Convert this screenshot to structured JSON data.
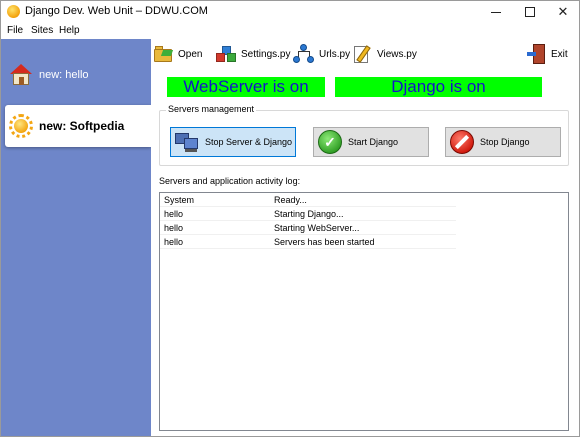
{
  "window": {
    "title": "Django Dev. Web Unit – DDWU.COM",
    "controls": {
      "minimize": "",
      "maximize": "",
      "close": "✕"
    }
  },
  "menu": [
    "File",
    "Sites",
    "Help"
  ],
  "sidebar": {
    "tabs": [
      {
        "label": "new: hello",
        "icon": "house-icon",
        "selected": false
      },
      {
        "label": "new: Softpedia",
        "icon": "sun-icon",
        "selected": true
      }
    ]
  },
  "toolbar": {
    "open": "Open",
    "settings": "Settings.py",
    "urls": "Urls.py",
    "views": "Views.py",
    "exit": "Exit"
  },
  "status": {
    "webserver": "WebServer is on",
    "django": "Django is on",
    "on_color": "#00ff00",
    "text_color": "#1414c8"
  },
  "servers": {
    "legend": "Servers management",
    "stop_all": "Stop Server & Django",
    "start_django": "Start Django",
    "stop_django": "Stop Django"
  },
  "log": {
    "label": "Servers and application activity log:",
    "rows": [
      {
        "source": "System",
        "message": "Ready..."
      },
      {
        "source": "hello",
        "message": "Starting Django..."
      },
      {
        "source": "hello",
        "message": "Starting WebServer..."
      },
      {
        "source": "hello",
        "message": "Servers has been started"
      }
    ]
  },
  "colors": {
    "sidebar": "#6e86c9",
    "selected_button": "#cce4f7"
  }
}
